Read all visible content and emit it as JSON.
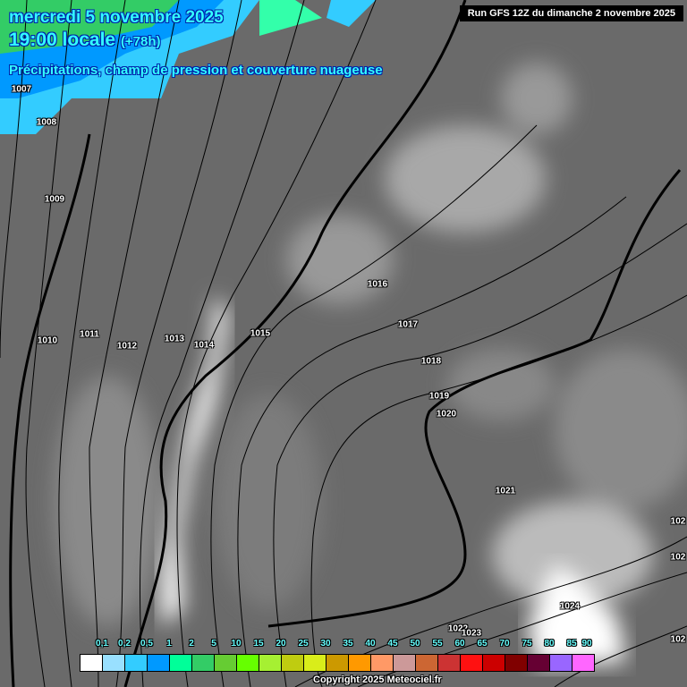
{
  "header": {
    "date": "mercredi 5 novembre 2025",
    "time": "19:00 locale",
    "offset": "(+78h)",
    "product": "Précipitations, champ de pression et couverture nuageuse",
    "run": "Run GFS 12Z du dimanche 2 novembre 2025"
  },
  "isobars": [
    "1007",
    "1008",
    "1009",
    "1010",
    "1011",
    "1012",
    "1013",
    "1014",
    "1015",
    "1016",
    "1017",
    "1018",
    "1019",
    "1020",
    "1021",
    "1022",
    "1023",
    "1024",
    "102",
    "102",
    "102"
  ],
  "legend": {
    "labels": [
      "0,1",
      "0,2",
      "0,5",
      "1",
      "2",
      "5",
      "10",
      "15",
      "20",
      "25",
      "30",
      "35",
      "40",
      "45",
      "50",
      "55",
      "60",
      "65",
      "70",
      "75",
      "80",
      "85",
      "90"
    ],
    "colors": [
      "#ffffff",
      "#99e0ff",
      "#33ccff",
      "#0099ff",
      "#00ff99",
      "#33cc66",
      "#66cc33",
      "#66ff00",
      "#a6f032",
      "#bfcc10",
      "#d9ed1a",
      "#cc9900",
      "#ff9900",
      "#ff9966",
      "#cc9999",
      "#cc6633",
      "#cc3333",
      "#ff1111",
      "#cc0000",
      "#800000",
      "#660033",
      "#9966ff",
      "#ff66ff"
    ]
  },
  "copyright": "Copyright 2025 Meteociel.fr"
}
